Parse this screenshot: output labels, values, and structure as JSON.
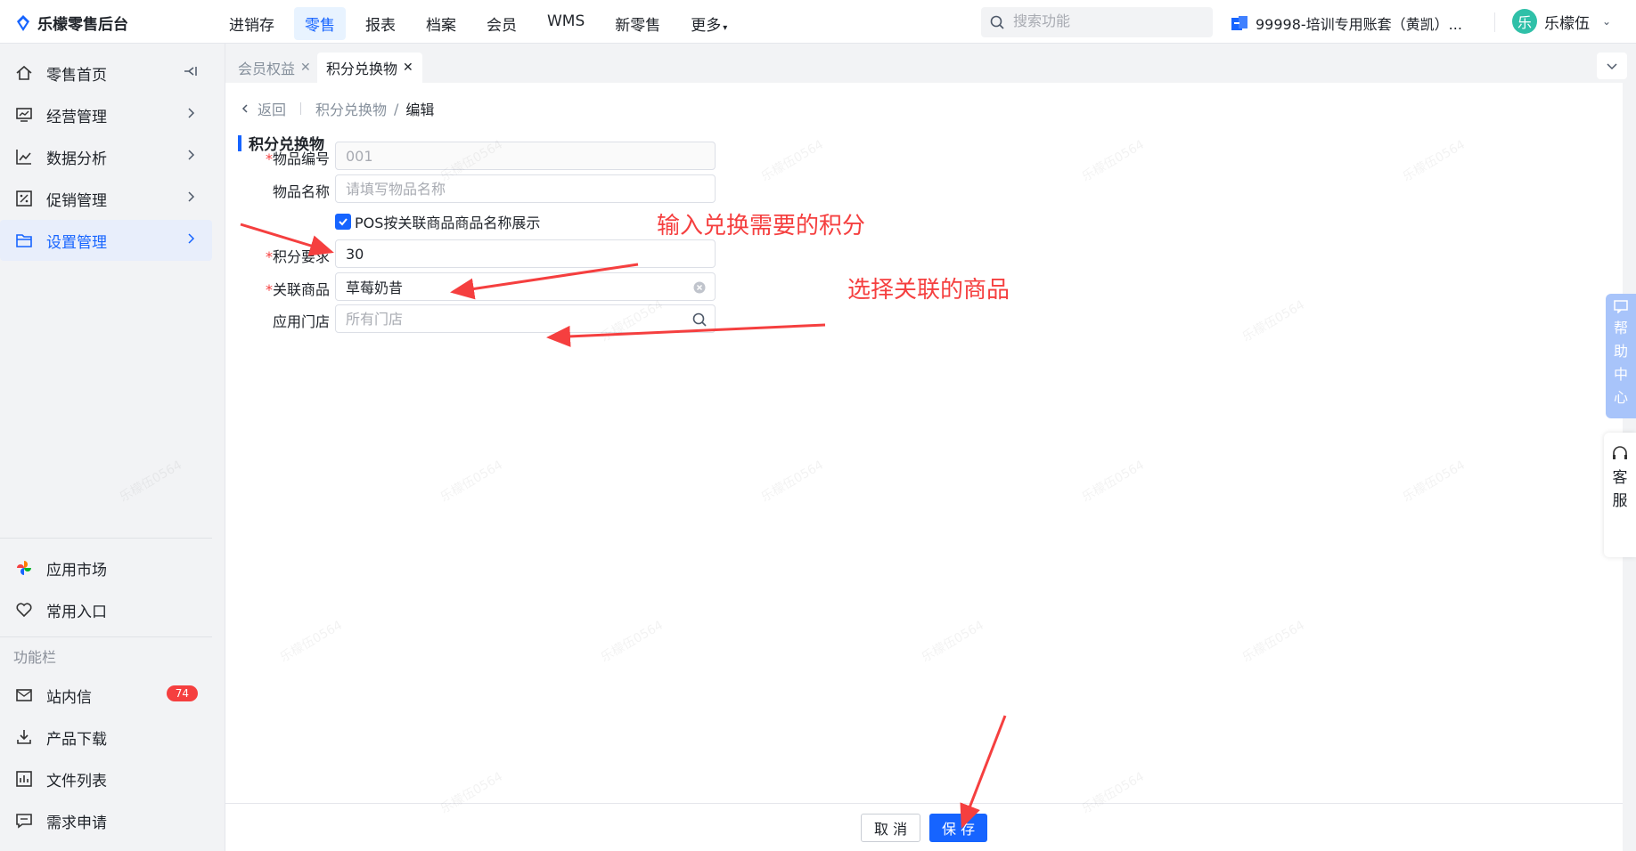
{
  "app": {
    "brand_title": "乐檬零售后台",
    "top_nav": [
      {
        "label": "进销存",
        "active": false
      },
      {
        "label": "零售",
        "active": true
      },
      {
        "label": "报表",
        "active": false
      },
      {
        "label": "档案",
        "active": false
      },
      {
        "label": "会员",
        "active": false
      },
      {
        "label": "WMS",
        "active": false
      },
      {
        "label": "新零售",
        "active": false
      },
      {
        "label": "更多",
        "active": false
      }
    ],
    "search_placeholder": "搜索功能",
    "account_name": "99998-培训专用账套（黄凯）...",
    "user_avatar_char": "乐",
    "user_name": "乐檬伍"
  },
  "sidebar": {
    "items": [
      {
        "label": "零售首页",
        "icon": "home-icon"
      },
      {
        "label": "经营管理",
        "icon": "monitor-icon"
      },
      {
        "label": "数据分析",
        "icon": "chart-line-icon"
      },
      {
        "label": "促销管理",
        "icon": "discount-icon"
      },
      {
        "label": "设置管理",
        "icon": "folder-icon",
        "active": true
      }
    ],
    "bottom_items": [
      {
        "label": "应用市场",
        "icon": "app-market-icon"
      },
      {
        "label": "常用入口",
        "icon": "heart-icon"
      }
    ],
    "section_title": "功能栏",
    "tool_items": [
      {
        "label": "站内信",
        "icon": "mail-icon",
        "badge": "74"
      },
      {
        "label": "产品下载",
        "icon": "download-icon"
      },
      {
        "label": "文件列表",
        "icon": "file-list-icon"
      },
      {
        "label": "需求申请",
        "icon": "request-icon"
      }
    ]
  },
  "tabs": [
    {
      "label": "会员权益",
      "active": false
    },
    {
      "label": "积分兑换物",
      "active": true
    }
  ],
  "breadcrumb": {
    "back": "返回",
    "parent": "积分兑换物",
    "separator": "/",
    "current": "编辑"
  },
  "form": {
    "section_title": "积分兑换物",
    "item_code": {
      "label": "物品编号",
      "required": "*",
      "placeholder": "001"
    },
    "item_name": {
      "label": "物品名称",
      "placeholder": "请填写物品名称"
    },
    "pos_display": {
      "label": "POS按关联商品商品名称展示",
      "checked": true
    },
    "points": {
      "label": "积分要求",
      "required": "*",
      "value": "30"
    },
    "related_product": {
      "label": "关联商品",
      "required": "*",
      "value": "草莓奶昔"
    },
    "store": {
      "label": "应用门店",
      "placeholder": "所有门店"
    }
  },
  "annotations": {
    "points_hint": "输入兑换需要的积分",
    "product_hint": "选择关联的商品"
  },
  "footer": {
    "cancel": "取 消",
    "save": "保 存"
  },
  "help_center": [
    "帮",
    "助",
    "中",
    "心"
  ],
  "customer_service": [
    "客",
    "服"
  ],
  "watermark": "乐檬伍0564",
  "colors": {
    "primary": "#1664ff",
    "annotation": "#f53f3f",
    "active_nav_bg": "#e8f3ff"
  }
}
